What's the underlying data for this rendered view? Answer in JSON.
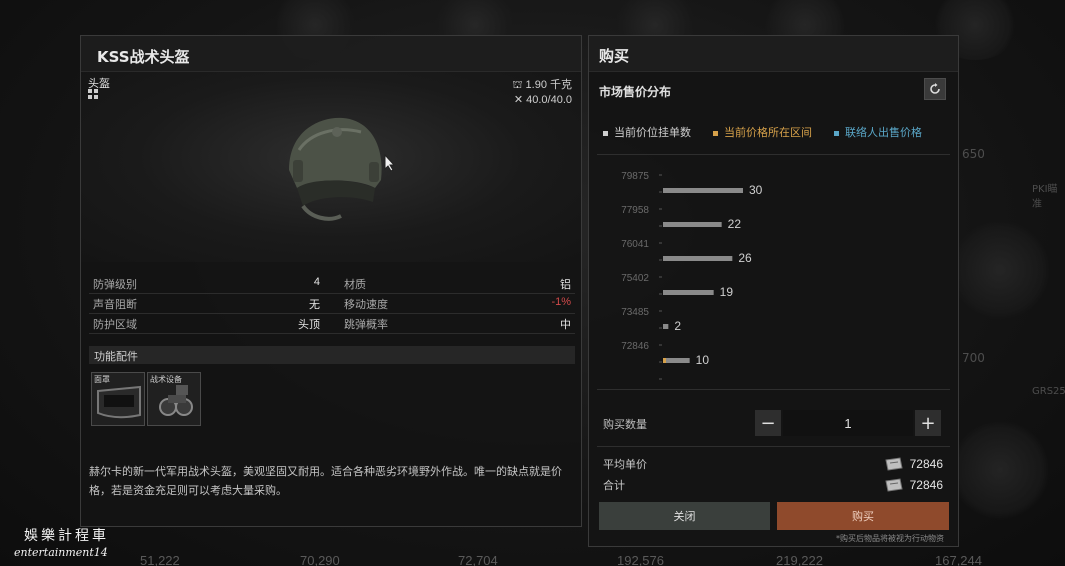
{
  "item": {
    "title": "KSS战术头盔",
    "category": "头盔",
    "weight": "1.90 千克",
    "durability": "40.0/40.0",
    "stats": [
      {
        "left_label": "防弹级别",
        "left_value": "4",
        "right_label": "材质",
        "right_value": "铝"
      },
      {
        "left_label": "声音阻断",
        "left_value": "无",
        "right_label": "移动速度",
        "right_value": "-1%"
      },
      {
        "left_label": "防护区域",
        "left_value": "头顶",
        "right_label": "跳弹概率",
        "right_value": "中"
      }
    ],
    "func_title": "功能配件",
    "slots": [
      "面罩",
      "战术设备"
    ],
    "description": "赫尔卡的新一代军用战术头盔，美观坚固又耐用。适合各种恶劣环境野外作战。唯一的缺点就是价格，若是资金充足则可以考虑大量采购。"
  },
  "buy": {
    "title": "购买",
    "market_title": "市场售价分布",
    "legend": [
      "当前价位挂单数",
      "当前价格所在区间",
      "联络人出售价格"
    ],
    "qty_label": "购买数量",
    "qty_value": "1",
    "avg_label": "平均单价",
    "avg_value": "72846",
    "total_label": "合计",
    "total_value": "72846",
    "close_label": "关闭",
    "buy_label": "购买",
    "note": "*购买后物品将被视为行动物资"
  },
  "background": {
    "prices": [
      "51,222",
      "70,290",
      "72,704",
      "192,576",
      "219,222",
      "167,244"
    ],
    "side": [
      "650",
      "700",
      "PKI瞄准",
      "GRS25"
    ]
  },
  "watermark": {
    "line1": "娛樂計程車",
    "line2": "entertainment14"
  },
  "colors": {
    "accent_buy": "#8f4a2c",
    "legend_orange": "#d6a14a",
    "legend_blue": "#5aa7c8",
    "negative": "#d24a4a"
  },
  "chart_data": {
    "type": "bar",
    "orientation": "horizontal",
    "categories": [
      "79875",
      "77958",
      "76041",
      "75402",
      "73485",
      "72846"
    ],
    "series": [
      {
        "name": "当前价位挂单数",
        "values": [
          30,
          22,
          26,
          19,
          2,
          10
        ]
      }
    ],
    "highlight_bar": 5,
    "xlim": [
      0,
      35
    ]
  }
}
